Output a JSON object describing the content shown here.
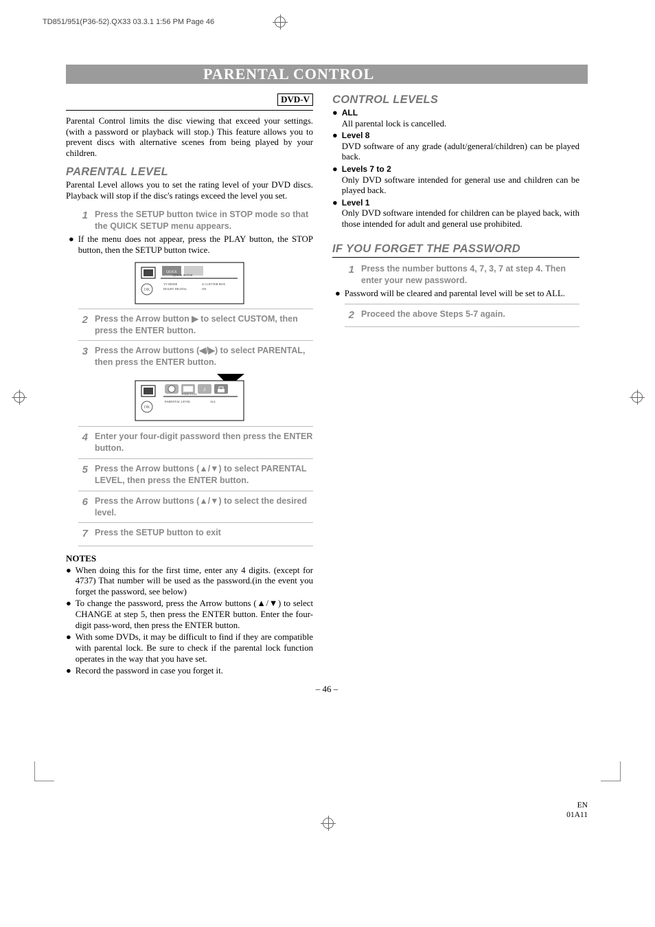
{
  "header_line": "TD851/951(P36-52).QX33  03.3.1 1:56 PM  Page 46",
  "title": "PARENTAL CONTROL",
  "badge": "DVD-V",
  "intro": "Parental Control limits the disc viewing that exceed your settings. (with a password or playback will stop.) This feature allows you to prevent discs with alternative scenes from being played by your children.",
  "parental_level": {
    "heading": "PARENTAL LEVEL",
    "text": "Parental Level allows you to set the rating level of your DVD discs. Playback will stop if the disc's ratings exceed the level you set."
  },
  "steps": [
    {
      "n": "1",
      "text": "Press the SETUP button twice in STOP mode so that the QUICK SETUP menu appears."
    },
    {
      "n": "2",
      "text": "Press the Arrow button ▶ to select CUSTOM, then press the ENTER button."
    },
    {
      "n": "3",
      "text": "Press the Arrow buttons (◀/▶) to select PARENTAL, then press the ENTER button."
    },
    {
      "n": "4",
      "text": "Enter your four-digit password then press the ENTER button."
    },
    {
      "n": "5",
      "text": "Press the Arrow buttons (▲/▼) to select PARENTAL LEVEL, then press the ENTER button."
    },
    {
      "n": "6",
      "text": "Press the Arrow buttons (▲/▼) to select the desired level."
    },
    {
      "n": "7",
      "text": "Press the SETUP button to exit"
    }
  ],
  "after_step1_bullet": "If the menu does not appear, press the PLAY button, the STOP button, then the SETUP button twice.",
  "notes": {
    "heading": "NOTES",
    "items": [
      "When doing this for the first time, enter any 4 digits. (except for 4737) That number will be used as the password.(in the event you forget the password, see below)",
      "To change the password, press the Arrow buttons (▲/▼) to select CHANGE at step 5, then press the ENTER button. Enter the four-digit pass-word, then press the ENTER button.",
      "With some DVDs, it may be difficult to find if they are compatible with parental lock. Be sure to check if the parental lock function operates in the way that you have set.",
      "Record the password in case you forget it."
    ]
  },
  "control_levels": {
    "heading": "CONTROL LEVELS",
    "items": [
      {
        "label": "ALL",
        "text": "All parental lock is cancelled."
      },
      {
        "label": "Level 8",
        "text": "DVD software of any grade (adult/general/children) can be played back."
      },
      {
        "label": "Levels 7 to 2",
        "text": "Only DVD software intended for general use and children can be played back."
      },
      {
        "label": "Level 1",
        "text": "Only DVD software intended for children can be played back, with those intended for adult and general use prohibited."
      }
    ]
  },
  "forget_password": {
    "heading": "IF YOU FORGET THE PASSWORD",
    "step1": "Press the number buttons 4, 7, 3, 7 at step 4. Then enter your new password.",
    "bullet": "Password will be cleared and parental level will be set to ALL.",
    "step2": "Proceed the above Steps 5-7 again."
  },
  "diagram1": {
    "tab": "QUICK SETUP",
    "row1a": "TV MODE",
    "row1b": "4:3 LETTER BOX",
    "row2a": "DOLBY DIGITAL",
    "row2b": "ON"
  },
  "diagram2": {
    "tab": "PARENTAL",
    "row1a": "PARENTAL LEVEL",
    "row1b": "ALL"
  },
  "page_number": "– 46 –",
  "footer": {
    "line1": "EN",
    "line2": "01A11"
  }
}
